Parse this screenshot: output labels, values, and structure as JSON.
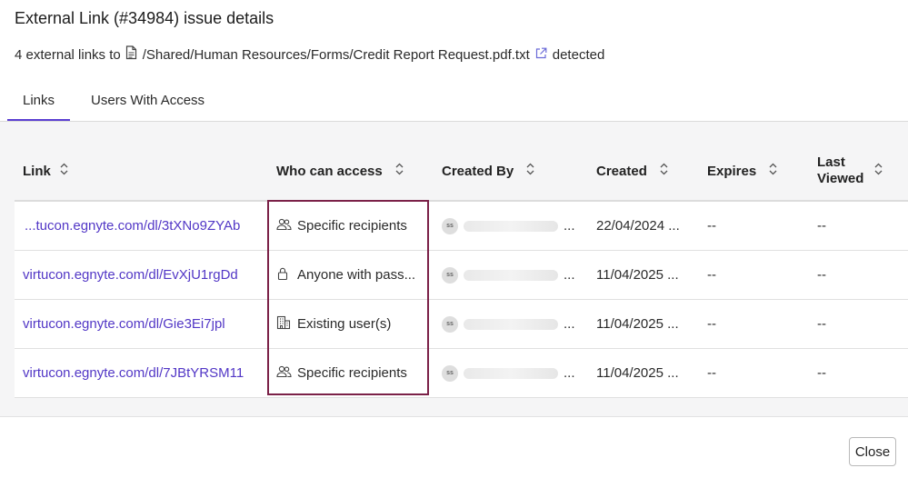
{
  "title": "External Link (#34984) issue details",
  "subtitle": {
    "prefix": "4 external links to",
    "path": "/Shared/Human Resources/Forms/Credit Report Request.pdf.txt",
    "suffix": "detected"
  },
  "tabs": [
    {
      "label": "Links",
      "active": true
    },
    {
      "label": "Users With Access",
      "active": false
    }
  ],
  "table": {
    "headers": {
      "link": "Link",
      "access": "Who can access",
      "created_by": "Created By",
      "created": "Created",
      "expires": "Expires",
      "last_viewed_1": "Last",
      "last_viewed_2": "Viewed"
    },
    "rows": [
      {
        "link": "...tucon.egnyte.com/dl/3tXNo9ZYAb",
        "access_icon": "people-icon",
        "access": "Specific recipients",
        "avatar": "ss",
        "created_by_ellipsis": "...",
        "created": "22/04/2024 ...",
        "expires": "--",
        "last_viewed": "--"
      },
      {
        "link": "virtucon.egnyte.com/dl/EvXjU1rgDd",
        "access_icon": "lock-icon",
        "access": "Anyone with pass...",
        "avatar": "ss",
        "created_by_ellipsis": "...",
        "created": "11/04/2025 ...",
        "expires": "--",
        "last_viewed": "--"
      },
      {
        "link": "virtucon.egnyte.com/dl/Gie3Ei7jpl",
        "access_icon": "building-icon",
        "access": "Existing user(s)",
        "avatar": "ss",
        "created_by_ellipsis": "...",
        "created": "11/04/2025 ...",
        "expires": "--",
        "last_viewed": "--"
      },
      {
        "link": "virtucon.egnyte.com/dl/7JBtYRSM11",
        "access_icon": "people-icon",
        "access": "Specific recipients",
        "avatar": "ss",
        "created_by_ellipsis": "...",
        "created": "11/04/2025 ...",
        "expires": "--",
        "last_viewed": "--"
      }
    ]
  },
  "close_label": "Close",
  "colors": {
    "accent": "#5b3fd1",
    "link": "#5237c6",
    "highlight": "#7b2148"
  }
}
